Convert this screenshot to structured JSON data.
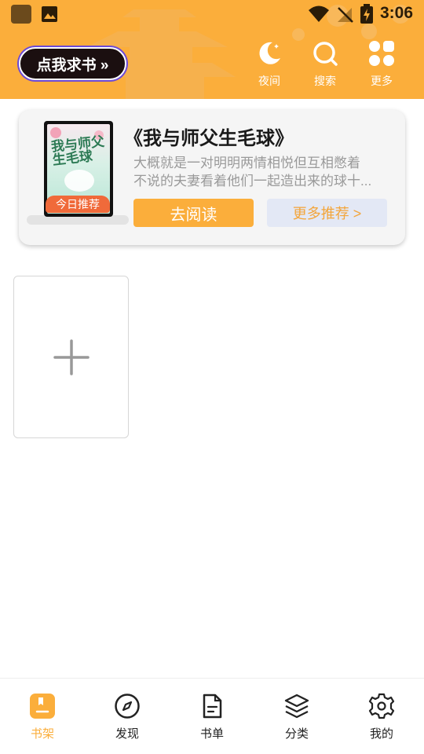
{
  "status_bar": {
    "time": "3:06",
    "icons": [
      "app-icon",
      "gallery-icon",
      "wifi-icon",
      "signal-off-icon",
      "battery-charging-icon"
    ]
  },
  "header": {
    "find_book_label": "点我求书 »",
    "actions": [
      {
        "label": "夜间",
        "icon": "moon-icon"
      },
      {
        "label": "搜索",
        "icon": "search-icon"
      },
      {
        "label": "更多",
        "icon": "grid-dots-icon"
      }
    ],
    "background_color": "#fbae3b"
  },
  "recommendation": {
    "badge": "今日推荐",
    "cover_title": "我与师父生毛球",
    "title": "《我与师父生毛球》",
    "description_line1": "大概就是一对明明两情相悦但互相憋着",
    "description_line2": "不说的夫妻看着他们一起造出来的球十...",
    "read_button": "去阅读",
    "more_button": "更多推荐 >"
  },
  "shelf": {
    "add_icon": "plus-icon"
  },
  "bottom_nav": {
    "items": [
      {
        "label": "书架",
        "icon": "bookshelf-icon",
        "active": true
      },
      {
        "label": "发现",
        "icon": "compass-icon",
        "active": false
      },
      {
        "label": "书单",
        "icon": "booklist-icon",
        "active": false
      },
      {
        "label": "分类",
        "icon": "layers-icon",
        "active": false
      },
      {
        "label": "我的",
        "icon": "gear-icon",
        "active": false
      }
    ],
    "active_color": "#fbae3b"
  }
}
